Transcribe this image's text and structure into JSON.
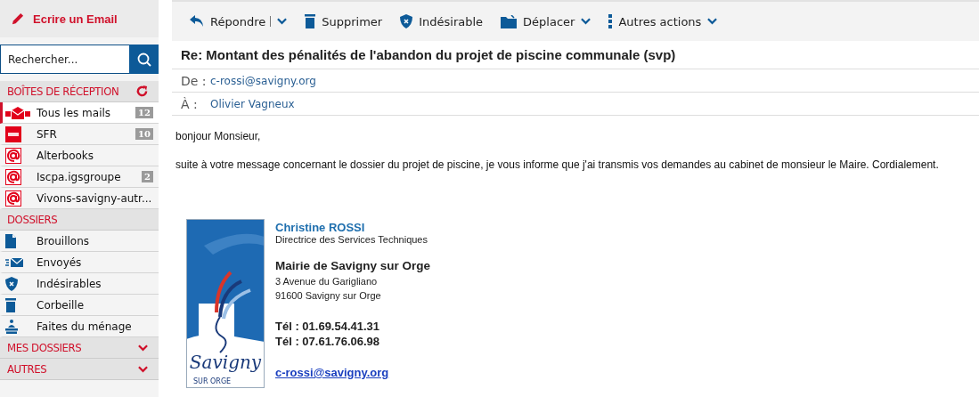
{
  "sidebar": {
    "compose_button": "Ecrire un Email",
    "search": {
      "placeholder": "Rechercher..."
    },
    "sections": [
      {
        "title": "BOÎTES DE RÉCEPTION",
        "expanded": true,
        "refresh": true,
        "items": [
          {
            "label": "Tous les mails",
            "kind": "all",
            "count": "12",
            "selected": true
          },
          {
            "label": "SFR",
            "kind": "sfr",
            "count": "10",
            "selected": false
          },
          {
            "label": "Alterbooks",
            "kind": "at",
            "selected": false
          },
          {
            "label": "Iscpa.igsgroupe",
            "kind": "at",
            "count": "2",
            "selected": false
          },
          {
            "label": "Vivons-savigny-autr...",
            "kind": "at",
            "selected": false
          }
        ]
      },
      {
        "title": "DOSSIERS",
        "expanded": true,
        "refresh": false,
        "items": [
          {
            "label": "Brouillons",
            "kind": "draft",
            "selected": false
          },
          {
            "label": "Envoyés",
            "kind": "sent",
            "selected": false
          },
          {
            "label": "Indésirables",
            "kind": "spam",
            "selected": false
          },
          {
            "label": "Corbeille",
            "kind": "trash",
            "selected": false
          },
          {
            "label": "Faites du ménage",
            "kind": "clean",
            "selected": false
          }
        ]
      },
      {
        "title": "MES DOSSIERS",
        "expanded": false,
        "refresh": false
      },
      {
        "title": "AUTRES",
        "expanded": false,
        "refresh": false
      }
    ]
  },
  "toolbar": [
    {
      "label": "Répondre",
      "kind": "reply",
      "split": true
    },
    {
      "label": "Supprimer",
      "kind": "trash"
    },
    {
      "label": "Indésirable",
      "kind": "spam"
    },
    {
      "label": "Déplacer",
      "kind": "move",
      "menu": true
    },
    {
      "label": "Autres actions",
      "kind": "more",
      "menu": true
    }
  ],
  "message": {
    "subject": "Re: Montant des pénalités de l'abandon du projet de piscine communale (svp)",
    "from": {
      "label": "De :",
      "value": "c-rossi@savigny.org"
    },
    "to": {
      "label": "À :",
      "value": "Olivier Vagneux"
    },
    "body": [
      "bonjour Monsieur,",
      "suite à votre message concernant  le dossier  du projet de piscine, je vous informe que j'ai transmis vos demandes au cabinet de monsieur le Maire. Cordialement."
    ],
    "signature": {
      "logo_text": "Savigny",
      "logo_subtext": "SUR ORGE",
      "name": "Christine ROSSI",
      "role": "Directrice des Services Techniques",
      "organization": "Mairie de Savigny sur Orge",
      "address": [
        "3 Avenue du Garigliano",
        "91600 Savigny sur Orge"
      ],
      "phones": [
        "Tél : 01.69.54.41.31",
        "Tél : 07.61.76.06.98"
      ],
      "email": "c-rossi@savigny.org"
    }
  }
}
